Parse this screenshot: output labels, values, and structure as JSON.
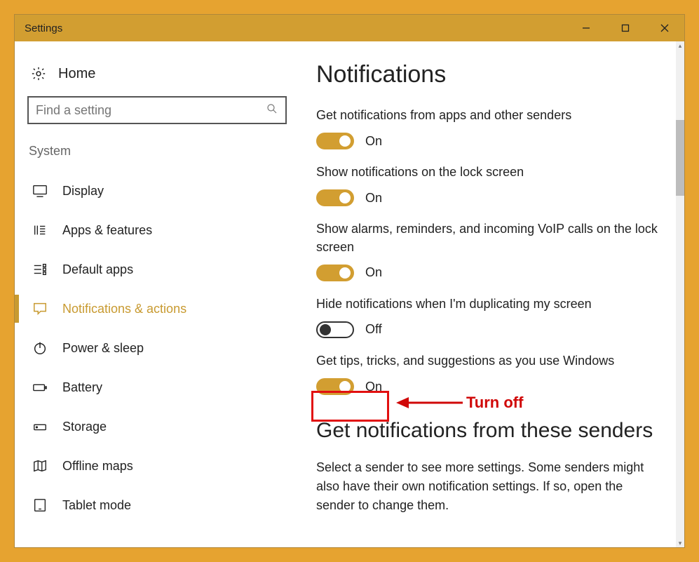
{
  "window": {
    "title": "Settings"
  },
  "home": {
    "label": "Home"
  },
  "search": {
    "placeholder": "Find a setting"
  },
  "section": {
    "label": "System"
  },
  "nav": [
    {
      "id": "display",
      "label": "Display"
    },
    {
      "id": "apps-features",
      "label": "Apps & features"
    },
    {
      "id": "default-apps",
      "label": "Default apps"
    },
    {
      "id": "notifications-actions",
      "label": "Notifications & actions"
    },
    {
      "id": "power-sleep",
      "label": "Power & sleep"
    },
    {
      "id": "battery",
      "label": "Battery"
    },
    {
      "id": "storage",
      "label": "Storage"
    },
    {
      "id": "offline-maps",
      "label": "Offline maps"
    },
    {
      "id": "tablet-mode",
      "label": "Tablet mode"
    }
  ],
  "main": {
    "heading": "Notifications",
    "settings": [
      {
        "label": "Get notifications from apps and other senders",
        "on": true,
        "state": "On"
      },
      {
        "label": "Show notifications on the lock screen",
        "on": true,
        "state": "On"
      },
      {
        "label": "Show alarms, reminders, and incoming VoIP calls on the lock screen",
        "on": true,
        "state": "On"
      },
      {
        "label": "Hide notifications when I'm duplicating my screen",
        "on": false,
        "state": "Off"
      },
      {
        "label": "Get tips, tricks, and suggestions as you use Windows",
        "on": true,
        "state": "On"
      }
    ],
    "senders_heading": "Get notifications from these senders",
    "senders_text": "Select a sender to see more settings. Some senders might also have their own notification settings. If so, open the sender to change them."
  },
  "annotation": {
    "text": "Turn off"
  },
  "colors": {
    "accent": "#d29e31"
  }
}
